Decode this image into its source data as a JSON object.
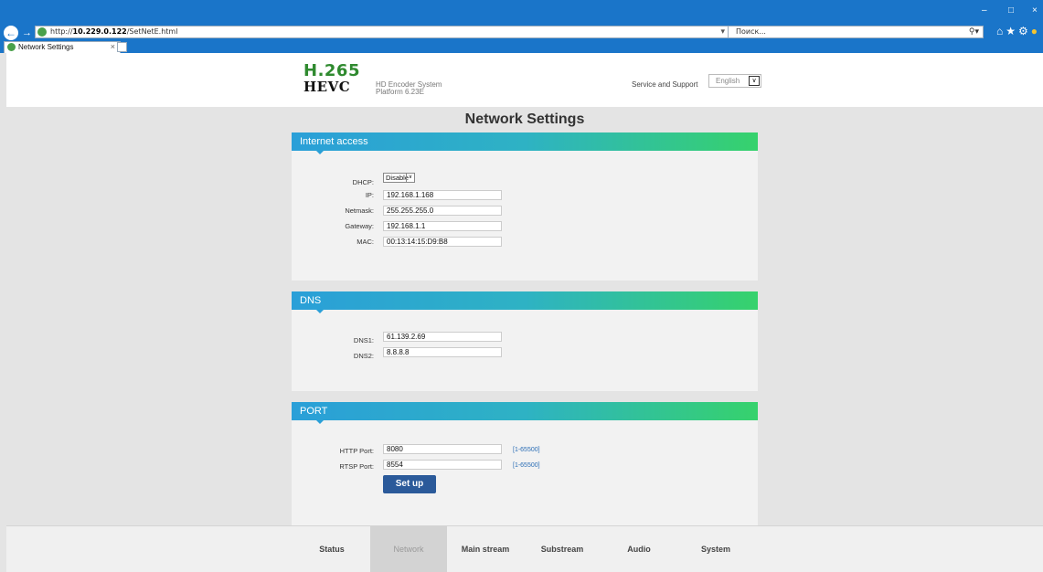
{
  "browser": {
    "url_prefix": "http://",
    "url_host": "10.229.0.122",
    "url_path": "/SetNetE.html",
    "search_placeholder": "Поиск...",
    "tab_title": "Network Settings"
  },
  "header": {
    "logo_line1": "H.265",
    "logo_line2": "HEVC",
    "system_name": "HD Encoder System",
    "platform": "Platform 6.23E",
    "support_link": "Service and Support",
    "language": "English"
  },
  "page": {
    "title": "Network Settings"
  },
  "internet": {
    "heading": "Internet access",
    "dhcp_label": "DHCP:",
    "dhcp_value": "Disable",
    "ip_label": "IP:",
    "ip_value": "192.168.1.168",
    "netmask_label": "Netmask:",
    "netmask_value": "255.255.255.0",
    "gateway_label": "Gateway:",
    "gateway_value": "192.168.1.1",
    "mac_label": "MAC:",
    "mac_value": "00:13:14:15:D9:B8"
  },
  "dns": {
    "heading": "DNS",
    "dns1_label": "DNS1:",
    "dns1_value": "61.139.2.69",
    "dns2_label": "DNS2:",
    "dns2_value": "8.8.8.8"
  },
  "port": {
    "heading": "PORT",
    "http_label": "HTTP Port:",
    "http_value": "8080",
    "http_range": "[1-65500]",
    "rtsp_label": "RTSP Port:",
    "rtsp_value": "8554",
    "rtsp_range": "[1-65500]",
    "setup_label": "Set up"
  },
  "nav": {
    "status": "Status",
    "network": "Network",
    "main_stream": "Main stream",
    "substream": "Substream",
    "audio": "Audio",
    "system": "System"
  },
  "colors": {
    "accent_blue": "#2a9fd8",
    "accent_green": "#36d26c",
    "button": "#2b5a9a",
    "logo_green": "#2f8a2f"
  }
}
